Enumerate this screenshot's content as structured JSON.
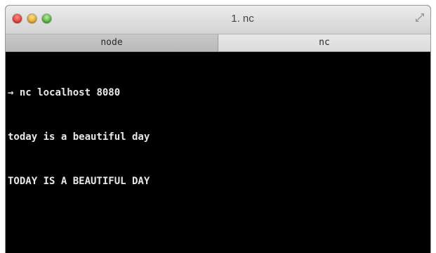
{
  "window": {
    "title": "1. nc"
  },
  "tabs": [
    {
      "label": "node",
      "active": false
    },
    {
      "label": "nc",
      "active": true
    }
  ],
  "terminal": {
    "prompt_symbol": "→",
    "lines": [
      "nc localhost 8080",
      "today is a beautiful day",
      "TODAY IS A BEAUTIFUL DAY"
    ]
  },
  "colors": {
    "terminal_bg": "#000000",
    "terminal_fg": "#e8e8e8",
    "close": "#e0443e",
    "minimize": "#e3a92b",
    "zoom": "#59b23f"
  },
  "icons": {
    "close": "close-traffic-light-icon",
    "minimize": "minimize-traffic-light-icon",
    "zoom": "zoom-traffic-light-icon",
    "fullscreen": "fullscreen-arrows-icon"
  }
}
